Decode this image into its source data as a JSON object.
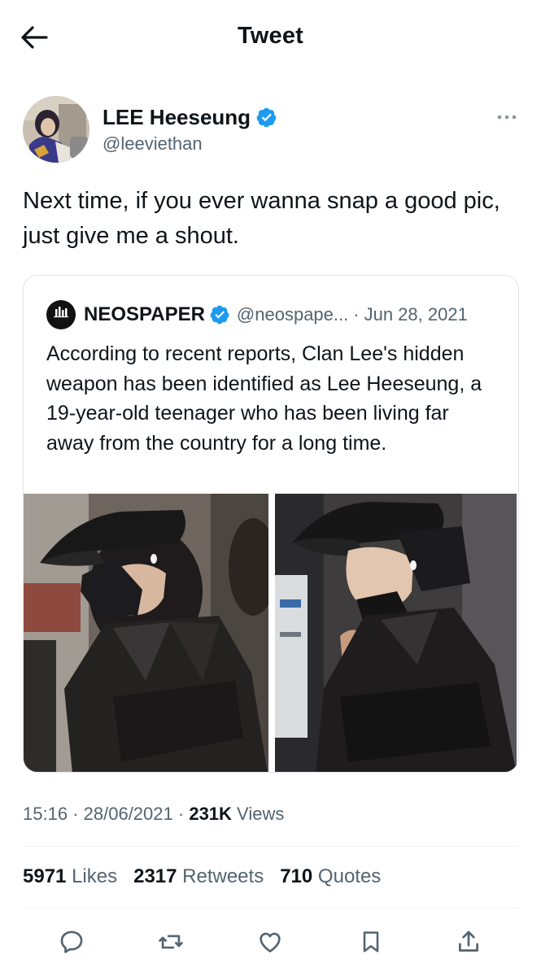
{
  "header": {
    "title": "Tweet",
    "back_icon": "arrow-left-icon"
  },
  "author": {
    "name": "LEE Heeseung",
    "handle": "@leeviethan",
    "verified_icon": "verified-badge-icon",
    "more_icon": "more-dots-icon"
  },
  "tweet": {
    "text": "Next time, if you ever wanna snap a good pic, just give me a shout."
  },
  "quote": {
    "logo_text": "NEOSPAPER",
    "name": "NEOSPAPER",
    "handle": "@neospape...",
    "separator": "·",
    "date": "Jun 28, 2021",
    "text": "According to recent reports, Clan Lee's hidden weapon has been identified as Lee Heeseung, a 19-year-old teenager who has been living far away from the country for a long time.",
    "photo_count": 2
  },
  "timestamp": {
    "time": "15:16",
    "sep1": "·",
    "date": "28/06/2021",
    "sep2": "·",
    "views_count": "231K",
    "views_label": "Views"
  },
  "stats": {
    "likes_count": "5971",
    "likes_label": "Likes",
    "retweets_count": "2317",
    "retweets_label": "Retweets",
    "quotes_count": "710",
    "quotes_label": "Quotes"
  },
  "actions": [
    "reply-icon",
    "retweet-icon",
    "like-icon",
    "bookmark-icon",
    "share-icon"
  ],
  "colors": {
    "verified": "#1d9bf0",
    "text": "#0f1419",
    "secondary": "#536471",
    "border": "#e1e6ea"
  }
}
